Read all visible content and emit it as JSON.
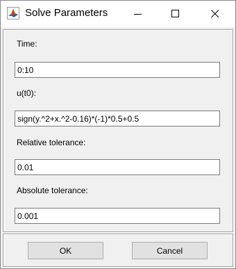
{
  "window": {
    "title": "Solve Parameters",
    "icon": "matlab-icon"
  },
  "caption_buttons": [
    "minimize",
    "maximize",
    "close"
  ],
  "fields": {
    "time": {
      "label": "Time:",
      "value": "0:10"
    },
    "u_t0": {
      "label": "u(t0):",
      "value": "sign(y.^2+x.^2-0.16)*(-1)*0.5+0.5"
    },
    "relative_tolerance": {
      "label": "Relative tolerance:",
      "value": "0.01"
    },
    "absolute_tolerance": {
      "label": "Absolute tolerance:",
      "value": "0.001"
    }
  },
  "buttons": {
    "ok": "OK",
    "cancel": "Cancel"
  },
  "colors": {
    "client_background": "#f0f0f0",
    "button_face": "#e1e1e1",
    "field_border": "#7a7a7a"
  }
}
